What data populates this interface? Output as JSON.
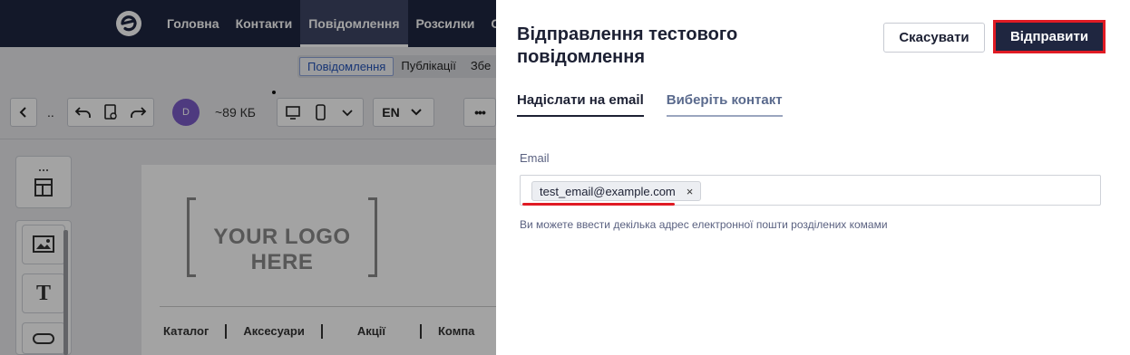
{
  "app": {
    "nav": [
      "Головна",
      "Контакти",
      "Повідомлення",
      "Розсилки",
      "Са"
    ],
    "active_nav": "Повідомлення",
    "subtabs": [
      "Повідомлення",
      "Публікації",
      "Збе"
    ],
    "toolbar": {
      "back": "‹",
      "ellipsis": "..",
      "avatar_initial": "D",
      "size": "~89 КБ",
      "lang": "EN",
      "more": "•••"
    },
    "canvas": {
      "logo_text": "YOUR LOGO HERE",
      "menu": [
        "Каталог",
        "Аксесуари",
        "Акції",
        "Компа"
      ]
    }
  },
  "modal": {
    "title": "Відправлення тестового повідомлення",
    "cancel_label": "Скасувати",
    "send_label": "Відправити",
    "tabs": [
      "Надіслати на email",
      "Виберіть контакт"
    ],
    "email_label": "Email",
    "email_chip": "test_email@example.com",
    "chip_remove": "×",
    "hint": "Ви можете ввести декілька адрес електронної пошти розділених комами"
  },
  "colors": {
    "topbar": "#1f2640",
    "accent_red": "#e01b24",
    "text_dark": "#1c2033"
  }
}
